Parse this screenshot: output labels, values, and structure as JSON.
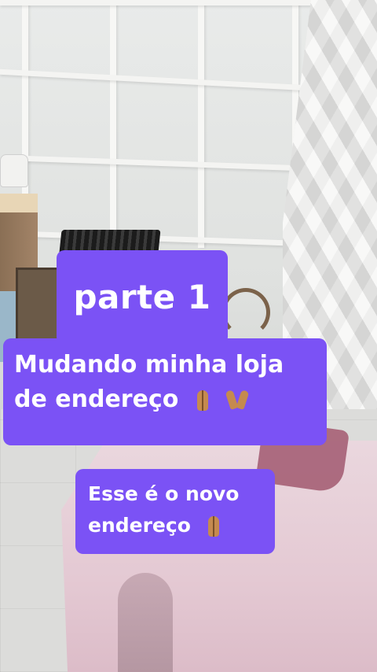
{
  "captions": {
    "title": "parte 1",
    "main_line1": "Mudando minha loja",
    "main_line2": "de endereço",
    "sub_line1": "Esse é o novo",
    "sub_line2": "endereço"
  },
  "icons": {
    "emoji_1": "folded-hands-icon",
    "emoji_2": "raising-hands-icon",
    "emoji_3": "folded-hands-icon"
  },
  "colors": {
    "sticker_background": "#7b52f5",
    "sticker_text": "#ffffff"
  }
}
